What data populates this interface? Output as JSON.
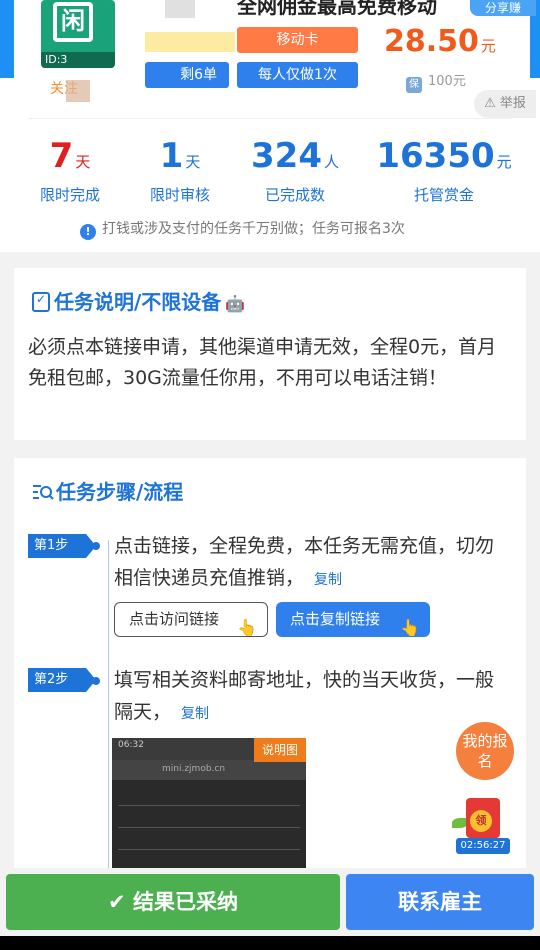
{
  "header": {
    "title": "全网佣金最高免费移动",
    "share_label": "分享赚",
    "logo_glyph": "闲",
    "id_label": "ID:3",
    "follow_label": "关注",
    "tag_card": "移动卡",
    "tag_remaining": "剩6单",
    "tag_once": "每人仅做1次",
    "price": "28.50",
    "price_unit": "元",
    "deposit": "100元",
    "report_label": "⚠ 举报"
  },
  "stats": [
    {
      "value": "7",
      "unit": "天",
      "label": "限时完成"
    },
    {
      "value": "1",
      "unit": "天",
      "label": "限时审核"
    },
    {
      "value": "324",
      "unit": "人",
      "label": "已完成数"
    },
    {
      "value": "16350",
      "unit": "元",
      "label": "托管赏金"
    }
  ],
  "notice": "打钱或涉及支付的任务千万别做；任务可报名3次",
  "description": {
    "heading": "任务说明/不限设备",
    "body": "必须点本链接申请，其他渠道申请无效，全程0元，首月免租包邮，30G流量任你用，不用可以电话注销！"
  },
  "steps": {
    "heading": "任务步骤/流程",
    "items": [
      {
        "tag": "第1步",
        "text": "点击链接，全程免费，本任务无需充值，切勿相信快递员充值推销，",
        "copy": "复制"
      },
      {
        "tag": "第2步",
        "text": "填写相关资料邮寄地址，快的当天收货，一般隔天，",
        "copy": "复制"
      }
    ],
    "visit_button": "点击访问链接",
    "copy_button": "点击复制链接",
    "thumb_label": "说明图",
    "thumb_time": "06:32",
    "thumb_url": "mini.zjmob.cn"
  },
  "floating": {
    "my_signup": "我的报名",
    "coin_label": "领",
    "timer": "02:56:27"
  },
  "footer": {
    "accepted": "结果已采纳",
    "contact": "联系雇主"
  },
  "colors": {
    "accent": "#1e73d8",
    "price": "#f05a1a",
    "accepted": "#4caf50",
    "contact": "#3d86f2"
  }
}
